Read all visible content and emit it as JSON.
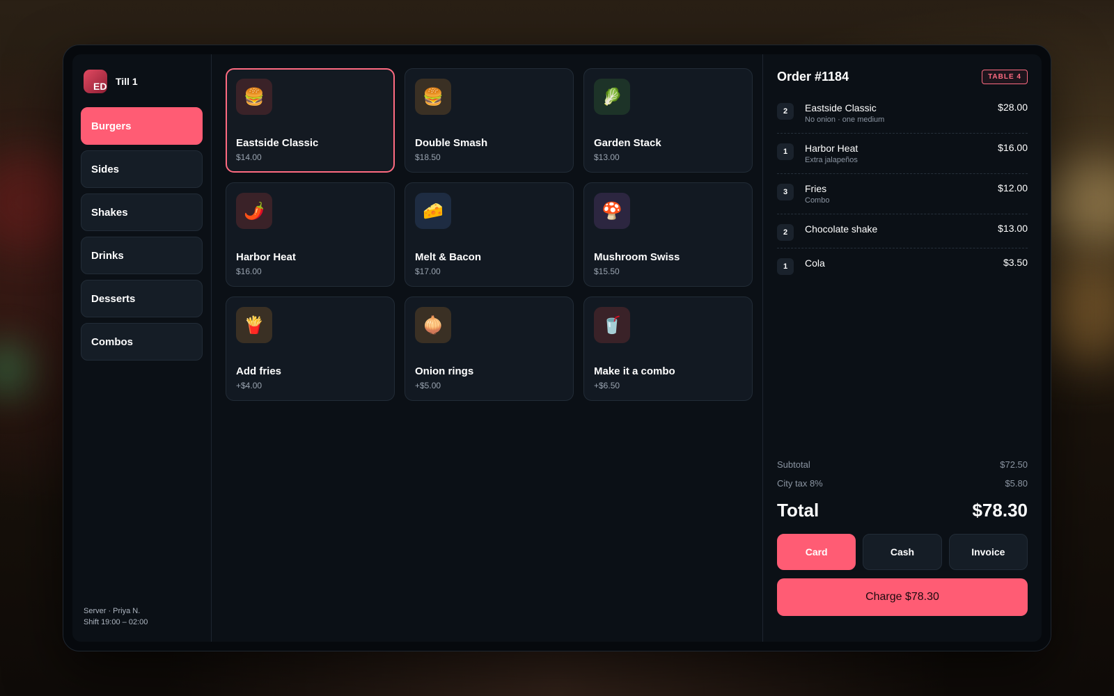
{
  "sidebar": {
    "logo_text": "ED",
    "till_label": "Till 1",
    "categories": [
      {
        "label": "Burgers",
        "active": true
      },
      {
        "label": "Sides"
      },
      {
        "label": "Shakes"
      },
      {
        "label": "Drinks"
      },
      {
        "label": "Desserts"
      },
      {
        "label": "Combos"
      }
    ],
    "server_line": "Server · Priya N.",
    "shift_line": "Shift 19:00 – 02:00"
  },
  "menu": {
    "items": [
      {
        "name": "Eastside Classic",
        "price": "$14.00",
        "icon": "🍔",
        "icon_name": "burger-icon",
        "icon_bg": "#3a2228",
        "selected": true
      },
      {
        "name": "Double Smash",
        "price": "$18.50",
        "icon": "🍔",
        "icon_name": "burger-icon",
        "icon_bg": "#3a3024"
      },
      {
        "name": "Garden Stack",
        "price": "$13.00",
        "icon": "🥬",
        "icon_name": "lettuce-icon",
        "icon_bg": "#1d3328"
      },
      {
        "name": "Harbor Heat",
        "price": "$16.00",
        "icon": "🌶️",
        "icon_name": "chili-pepper-icon",
        "icon_bg": "#3a2228"
      },
      {
        "name": "Melt & Bacon",
        "price": "$17.00",
        "icon": "🧀",
        "icon_name": "cheese-icon",
        "icon_bg": "#1e2c42"
      },
      {
        "name": "Mushroom Swiss",
        "price": "$15.50",
        "icon": "🍄",
        "icon_name": "mushroom-icon",
        "icon_bg": "#2c2640"
      },
      {
        "name": "Add fries",
        "price": "+$4.00",
        "icon": "🍟",
        "icon_name": "fries-icon",
        "icon_bg": "#3a3024"
      },
      {
        "name": "Onion rings",
        "price": "+$5.00",
        "icon": "🧅",
        "icon_name": "onion-icon",
        "icon_bg": "#3a3024"
      },
      {
        "name": "Make it a combo",
        "price": "+$6.50",
        "icon": "🥤",
        "icon_name": "cup-icon",
        "icon_bg": "#3a2228"
      }
    ]
  },
  "order": {
    "title": "Order #1184",
    "table_badge": "TABLE 4",
    "lines": [
      {
        "qty": "2",
        "name": "Eastside Classic",
        "note": "No onion · one medium",
        "price": "$28.00"
      },
      {
        "qty": "1",
        "name": "Harbor Heat",
        "note": "Extra jalapeños",
        "price": "$16.00"
      },
      {
        "qty": "3",
        "name": "Fries",
        "note": "Combo",
        "price": "$12.00"
      },
      {
        "qty": "2",
        "name": "Chocolate shake",
        "note": "",
        "price": "$13.00"
      },
      {
        "qty": "1",
        "name": "Cola",
        "note": "",
        "price": "$3.50"
      }
    ],
    "subtotal_label": "Subtotal",
    "subtotal_value": "$72.50",
    "tax_label": "City tax 8%",
    "tax_value": "$5.80",
    "total_label": "Total",
    "total_value": "$78.30",
    "payment_methods": [
      {
        "label": "Card",
        "active": true
      },
      {
        "label": "Cash"
      },
      {
        "label": "Invoice"
      }
    ],
    "charge_label": "Charge $78.30"
  },
  "colors": {
    "accent": "#ff5c74",
    "panel": "#0b1016",
    "card": "#121922"
  }
}
